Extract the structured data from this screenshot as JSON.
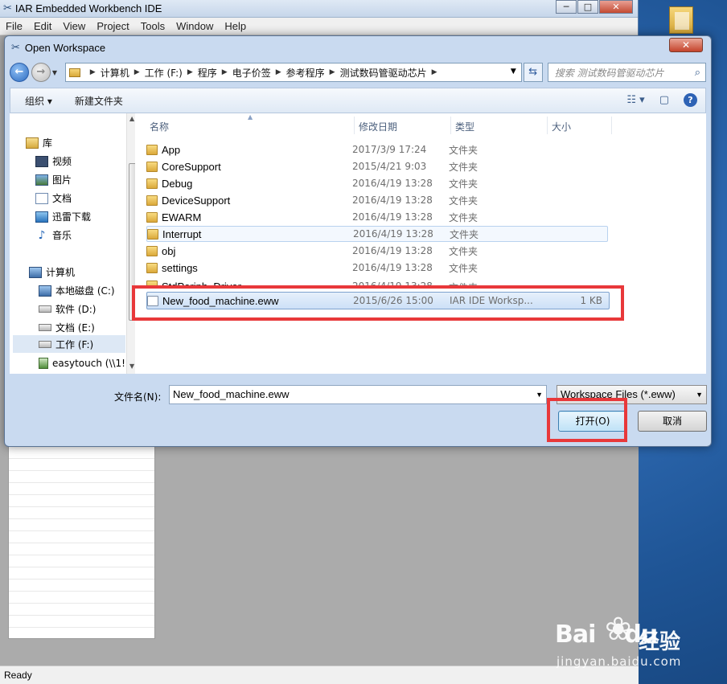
{
  "ide": {
    "title": "IAR Embedded Workbench IDE",
    "menu": [
      "File",
      "Edit",
      "View",
      "Project",
      "Tools",
      "Window",
      "Help"
    ],
    "status": "Ready",
    "win_minimize": "─",
    "win_maximize": "□",
    "win_close": "✕"
  },
  "dialog": {
    "title": "Open Workspace",
    "close_label": "✕",
    "breadcrumbs": [
      "计算机",
      "工作 (F:)",
      "程序",
      "电子价签",
      "参考程序",
      "测试数码管驱动芯片"
    ],
    "search_placeholder": "搜索 测试数码管驱动芯片",
    "toolbar": {
      "organize": "组织 ▾",
      "new_folder": "新建文件夹"
    },
    "nav": {
      "favorites_header": "库",
      "library_items": [
        "视频",
        "图片",
        "文档",
        "迅雷下载",
        "音乐"
      ],
      "computer_header": "计算机",
      "drives": [
        "本地磁盘 (C:)",
        "软件 (D:)",
        "文档 (E:)",
        "工作 (F:)",
        "easytouch (\\\\1!"
      ],
      "selected_drive": "工作 (F:)"
    },
    "columns": {
      "name": "名称",
      "date": "修改日期",
      "type": "类型",
      "size": "大小"
    },
    "files": [
      {
        "name": "App",
        "date": "2017/3/9 17:24",
        "type": "文件夹",
        "size": ""
      },
      {
        "name": "CoreSupport",
        "date": "2015/4/21 9:03",
        "type": "文件夹",
        "size": ""
      },
      {
        "name": "Debug",
        "date": "2016/4/19 13:28",
        "type": "文件夹",
        "size": ""
      },
      {
        "name": "DeviceSupport",
        "date": "2016/4/19 13:28",
        "type": "文件夹",
        "size": ""
      },
      {
        "name": "EWARM",
        "date": "2016/4/19 13:28",
        "type": "文件夹",
        "size": ""
      },
      {
        "name": "Interrupt",
        "date": "2016/4/19 13:28",
        "type": "文件夹",
        "size": ""
      },
      {
        "name": "obj",
        "date": "2016/4/19 13:28",
        "type": "文件夹",
        "size": ""
      },
      {
        "name": "settings",
        "date": "2016/4/19 13:28",
        "type": "文件夹",
        "size": ""
      },
      {
        "name": "StdPeriph_Driver",
        "date": "2016/4/19 13:28",
        "type": "文件夹",
        "size": ""
      },
      {
        "name": "New_food_machine.eww",
        "date": "2015/6/26 15:00",
        "type": "IAR IDE Worksp...",
        "size": "1 KB"
      }
    ],
    "filename_label": "文件名(N):",
    "filename_value": "New_food_machine.eww",
    "filetype_value": "Workspace Files (*.eww)",
    "open_button": "打开(O)",
    "cancel_button": "取消"
  },
  "watermark": {
    "brand": "Bai",
    "brand_suffix": "du",
    "cn": "经验",
    "url": "jingyan.baidu.com"
  },
  "colors": {
    "highlight": "#e8383a",
    "titlebar": "#c9daf0",
    "selection": "#cde0f7"
  }
}
